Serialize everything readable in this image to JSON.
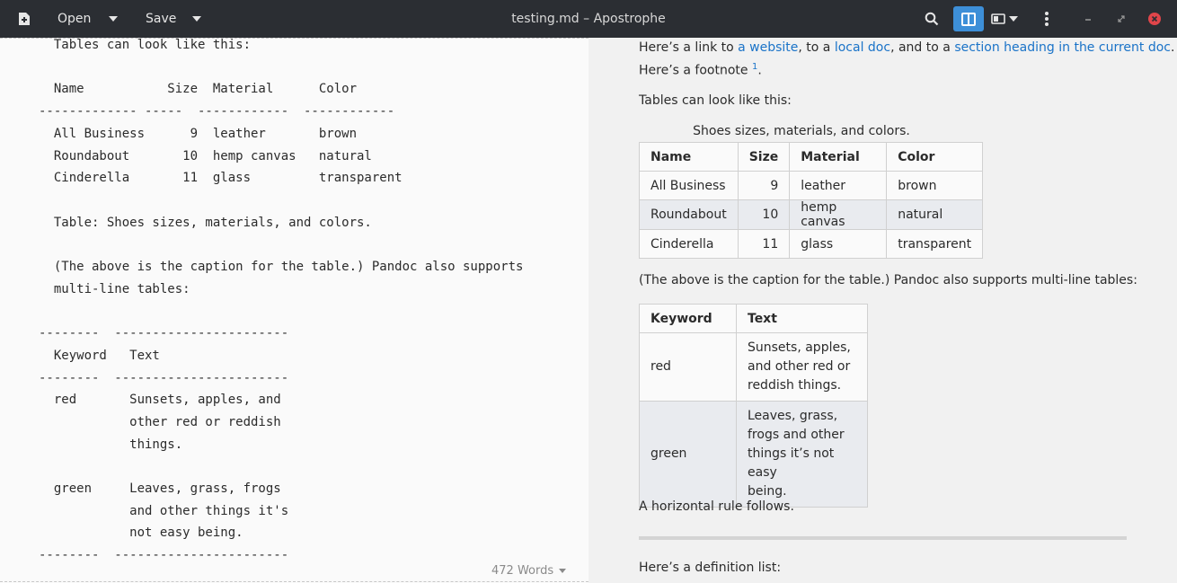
{
  "header": {
    "title": "testing.md – Apostrophe",
    "open_label": "Open",
    "save_label": "Save"
  },
  "editor": {
    "lines": [
      "  Tables can look like this:",
      "",
      "  Name           Size  Material      Color",
      "------------- -----  ------------  ------------",
      "  All Business      9  leather       brown",
      "  Roundabout       10  hemp canvas   natural",
      "  Cinderella       11  glass         transparent",
      "",
      "  Table: Shoes sizes, materials, and colors.",
      "",
      "  (The above is the caption for the table.) Pandoc also supports",
      "  multi-line tables:",
      "",
      "--------  -----------------------",
      "  Keyword   Text",
      "--------  -----------------------",
      "  red       Sunsets, apples, and",
      "            other red or reddish",
      "            things.",
      "",
      "  green     Leaves, grass, frogs",
      "            and other things it's",
      "            not easy being.",
      "--------  -----------------------"
    ],
    "word_count": "472 Words"
  },
  "preview": {
    "link_intro": "Here’s a link to ",
    "link1": "a website",
    "link_sep1": ", to a ",
    "link2": "local doc",
    "link_sep2": ", and to a ",
    "link3": "section heading in the current doc",
    "link_end": ".",
    "footnote_text": "Here’s a footnote ",
    "footnote_ref": "1",
    "footnote_end": ".",
    "tables_intro": "Tables can look like this:",
    "table1": {
      "caption": "Shoes sizes, materials, and colors.",
      "headers": [
        "Name",
        "Size",
        "Material",
        "Color"
      ],
      "rows": [
        [
          "All Business",
          "9",
          "leather",
          "brown"
        ],
        [
          "Roundabout",
          "10",
          "hemp canvas",
          "natural"
        ],
        [
          "Cinderella",
          "11",
          "glass",
          "transparent"
        ]
      ]
    },
    "multiline_intro": "(The above is the caption for the table.) Pandoc also supports multi-line tables:",
    "table2": {
      "headers": [
        "Keyword",
        "Text"
      ],
      "rows": [
        {
          "keyword": "red",
          "text": [
            "Sunsets, apples,",
            "and other red or",
            "reddish things."
          ]
        },
        {
          "keyword": "green",
          "text": [
            "Leaves, grass,",
            "frogs and other",
            "things it’s not easy",
            "being."
          ]
        }
      ]
    },
    "hr_intro": "A horizontal rule follows.",
    "deflist_intro": "Here’s a definition list:"
  },
  "colors": {
    "headerbar": "#2b2e33",
    "accent": "#3d8fd8",
    "link": "#1a73c8",
    "close": "#e0454a"
  }
}
